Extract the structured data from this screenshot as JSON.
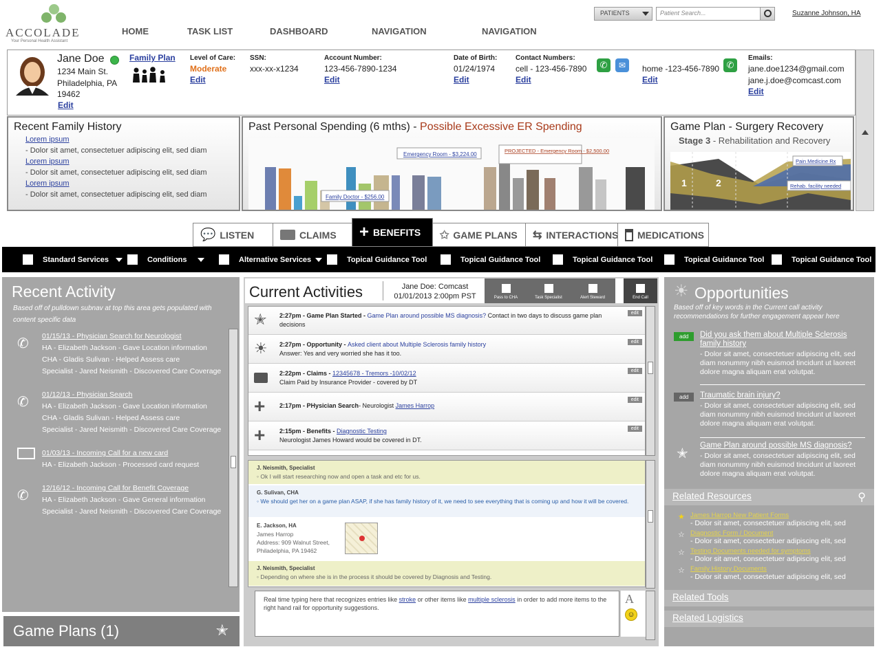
{
  "brand": {
    "name": "ACCOLADE",
    "tagline": "Your Personal Health Assistant"
  },
  "nav": [
    "HOME",
    "TASK LIST",
    "DASHBOARD",
    "NAVIGATION",
    "NAVIGATION"
  ],
  "search": {
    "scope": "PATIENTS",
    "placeholder": "Patient Search..."
  },
  "user": "Suzanne Johnson, HA",
  "patient": {
    "name": "Jane Doe",
    "status_color": "#3cb54a",
    "plan_link": "Family Plan",
    "address": [
      "1234 Main St.",
      "Philadelphia, PA",
      "19462"
    ],
    "edit": "Edit",
    "level_label": "Level of Care:",
    "level_value": "Moderate",
    "ssn_label": "SSN:",
    "ssn_value": "xxx-xx-x1234",
    "account_label": "Account Number:",
    "account_value": "123-456-7890-1234",
    "dob_label": "Date of Birth:",
    "dob_value": "01/24/1974",
    "contact_label": "Contact Numbers:",
    "contact_cell": "cell - 123-456-7890",
    "contact_home": "home -123-456-7890",
    "emails_label": "Emails:",
    "email1": "jane.doe1234@gmail.com",
    "email2": "jane.j.doe@comcast.com"
  },
  "family_history": {
    "title": "Recent Family History",
    "items": [
      {
        "link": "Lorem ipsum",
        "text": "- Dolor sit amet, consectetuer adipiscing elit, sed diam"
      },
      {
        "link": "Lorem ipsum",
        "text": "- Dolor sit amet, consectetuer adipiscing elit, sed diam"
      },
      {
        "link": "Lorem ipsum",
        "text": "- Dolor sit amet, consectetuer adipiscing elit, sed diam"
      }
    ]
  },
  "spending": {
    "title": "Past Personal Spending (6 mths) - ",
    "alert": "Possible Excessive ER Spending",
    "callouts": [
      "Emergency Room - $3,224.00",
      "PROJECTED - Emergency Room - $2,500.00",
      "Family Doctor - $256.00"
    ]
  },
  "gameplan_panel": {
    "title": "Game Plan - Surgery Recovery",
    "stage": "Stage 3",
    "stage_text": " - Rehabilitation and Recovery",
    "labels": [
      "Pain Medicine Rx",
      "Rehab. facility needed"
    ],
    "markers": [
      "1",
      "2"
    ]
  },
  "tabs": [
    {
      "icon": "speech-bubbles-icon",
      "label": "LISTEN"
    },
    {
      "icon": "folder-icon",
      "label": "CLAIMS"
    },
    {
      "icon": "plus-icon",
      "label": "BENEFITS"
    },
    {
      "icon": "star-icon",
      "label": "GAME PLANS"
    },
    {
      "icon": "arrows-icon",
      "label": "INTERACTIONS"
    },
    {
      "icon": "pill-bottle-icon",
      "label": "MEDICATIONS"
    }
  ],
  "active_tab": "BENEFITS",
  "subnav": [
    {
      "label": "Standard Services",
      "dropdown": true
    },
    {
      "label": "Conditions",
      "dropdown": true
    },
    {
      "label": "Alternative Services",
      "dropdown": true
    },
    {
      "label": "Topical Guidance Tool",
      "dropdown": false
    },
    {
      "label": "Topical Guidance Tool",
      "dropdown": false
    },
    {
      "label": "Topical Guidance Tool",
      "dropdown": false
    },
    {
      "label": "Topical Guidance Tool",
      "dropdown": false
    },
    {
      "label": "Topical Guidance Tool",
      "dropdown": false
    }
  ],
  "recent_activity": {
    "title": "Recent Activity",
    "note": "Based off of pulldown subnav at top this area gets populated with content specific data",
    "items": [
      {
        "icon": "phone-icon",
        "link": "01/15/13 - Physician Search for Neurologist",
        "lines": [
          "HA - Elizabeth Jackson - Gave Location information",
          "CHA - Gladis Sulivan - Helped Assess care",
          "Specialist - Jared Neismith - Discovered Care Coverage"
        ]
      },
      {
        "icon": "phone-icon",
        "link": "01/12/13 - Physician Search ",
        "lines": [
          "HA - Elizabeth Jackson - Gave Location information",
          "CHA - Gladis Sulivan - Helped Assess care",
          "Specialist - Jared Neismith - Discovered Care Coverage"
        ]
      },
      {
        "icon": "envelope-icon",
        "link": "01/03/13 - Incoming Call for a new card",
        "lines": [
          "HA - Elizabeth Jackson - Processed card  request"
        ]
      },
      {
        "icon": "phone-icon",
        "link": "12/16/12 - Incoming Call for Benefit Coverage",
        "lines": [
          "HA - Elizabeth Jackson - Gave General information",
          "Specialist - Jared Neismith - Discovered Care Coverage"
        ]
      }
    ]
  },
  "game_plans": "Game Plans  (1)",
  "current": {
    "title": "Current Activities",
    "who": "Jane Doe: Comcast",
    "when": "01/01/2013  2:00pm PST",
    "buttons": [
      "Pass to CHA",
      "Task Specialist",
      "Alert Steward",
      "End Call"
    ],
    "edit": "edit",
    "feed": [
      {
        "icon": "star",
        "time": "2:27pm - Game Plan Started - ",
        "link": "Game Plan around possible MS diagnosis?",
        "rest": " Contact in two days to discuss game plan decisions"
      },
      {
        "icon": "sun",
        "time": "2:27pm - Opportunity - ",
        "link": "Asked client about Multiple Sclerosis family history",
        "rest": "Answer: Yes and very worried she has it too."
      },
      {
        "icon": "folder",
        "time": "2:22pm - Claims - ",
        "link": "12345678 - Tremors -10/02/12",
        "rest": "Claim Paid by Insurance Provider - covered by DT"
      },
      {
        "icon": "plus",
        "time": "2:17pm - PHysician Search",
        "link": "James Harrop",
        "rest": "- Neurologist "
      },
      {
        "icon": "plus",
        "time": "2:15pm - Benefits - ",
        "link": "Diagnostic Testing",
        "rest": "Neurologist James Howard would be covered in DT."
      }
    ],
    "chat": [
      {
        "who": "J. Neismith, Specialist",
        "text": "Ok I will start researching now and open a task and etc for us."
      },
      {
        "who": "G. Sulivan, CHA",
        "text": "We should get her on a game plan ASAP, if she has family history of it, we need to see everything that is coming up and how it will be covered."
      },
      {
        "who": "E. Jackson, HA",
        "text": "James Harrop",
        "addr1": "Address: 909 Walnut Street,",
        "addr2": "Philadelphia, PA 19462"
      },
      {
        "who": "J. Neismith, Specialist",
        "text": "Depending on where she is in the process it should be covered by Diagnosis and Testing."
      }
    ],
    "composer_a": "Real time typing here that recognizes entries like ",
    "composer_link1": "stroke",
    "composer_b": " or other items like ",
    "composer_link2": "multiple sclerosis",
    "composer_c": " in order to add more items to the right hand rail for opportunity suggestions."
  },
  "opportunities": {
    "title": "Opportunities",
    "note": "Based off of key words in the Current call activity recommendations for further engagement appear here",
    "add": "add",
    "items": [
      {
        "link": "Did you ask them about Multiple Sclerosis family history",
        "text": "- Dolor sit amet, consectetuer adipiscing elit, sed diam nonummy nibh euismod tincidunt ut laoreet dolore magna aliquam erat volutpat."
      },
      {
        "link": "Traumatic brain injury?",
        "text": "- Dolor sit amet, consectetuer adipiscing elit, sed diam nonummy nibh euismod tincidunt ut laoreet dolore magna aliquam erat volutpat."
      },
      {
        "link": "Game Plan around possible MS diagnosis?",
        "text": "- Dolor sit amet, consectetuer adipiscing elit, sed diam nonummy nibh euismod tincidunt ut laoreet dolore magna aliquam erat volutpat."
      }
    ],
    "related_resources": "Related Resources",
    "resources": [
      {
        "link": "James Harrop New Patient Forms",
        "text": "- Dolor sit amet, consectetuer adipiscing elit, sed"
      },
      {
        "link": "Diagnostic Form / Document",
        "text": "- Dolor sit amet, consectetuer adipiscing elit, sed"
      },
      {
        "link": "Testing Documents needed for symptoms",
        "text": "- Dolor sit amet, consectetuer adipiscing elit, sed"
      },
      {
        "link": "Family History Documents",
        "text": "- Dolor sit amet, consectetuer adipiscing elit, sed"
      }
    ],
    "related_tools": "Related Tools",
    "related_logistics": "Related Logistics"
  }
}
